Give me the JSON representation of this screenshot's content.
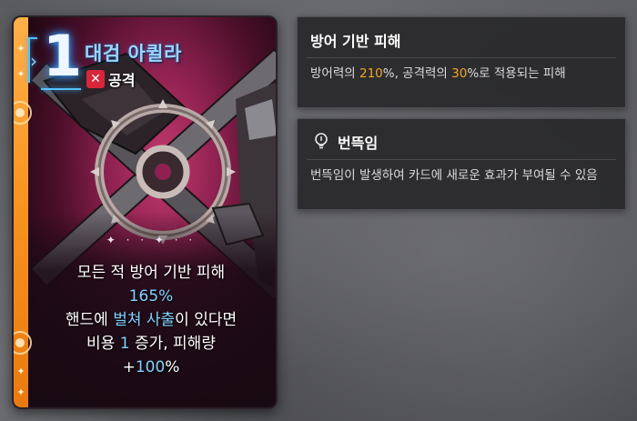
{
  "card": {
    "cost": "1",
    "name": "대검 아퀼라",
    "type_label": "공격",
    "type_icon": "crossed-swords-icon",
    "divider": "✦ · · ✦ · ·",
    "description": {
      "line1": "모든 적 방어 기반 피해",
      "line2": "165%",
      "line3_pre": "핸드에 ",
      "line3_hl": "벌쳐 사출",
      "line3_post": "이 있다면",
      "line4_pre": "비용 ",
      "line4_hl": "1",
      "line4_post": " 증가, 피해량",
      "line5_pre": "+",
      "line5_hl": "100",
      "line5_post": "%"
    },
    "colors": {
      "stripe": "#f7921e",
      "highlight": "#7fd2ff",
      "title": "#9dd5ff",
      "type_icon_bg": "#d8263a"
    }
  },
  "tooltips": [
    {
      "title": "방어 기반 피해",
      "body_pre": "방어력의 ",
      "num1": "210",
      "body_mid": "%, 공격력의 ",
      "num2": "30",
      "body_post": "%로 적용되는 피해"
    },
    {
      "icon": "lightbulb-icon",
      "title": "번뜩임",
      "body": "번뜩임이 발생하여 카드에 새로운 효과가 부여될 수 있음"
    }
  ],
  "accent_number_color": "#f5a623"
}
